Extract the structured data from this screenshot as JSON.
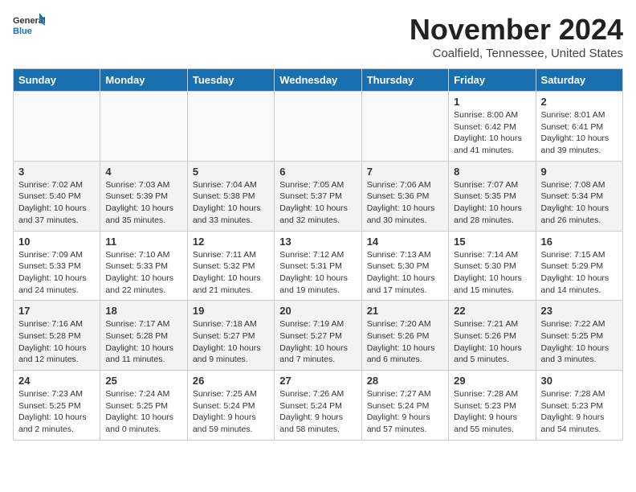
{
  "header": {
    "logo": {
      "general": "General",
      "blue": "Blue"
    },
    "month": "November 2024",
    "location": "Coalfield, Tennessee, United States"
  },
  "weekdays": [
    "Sunday",
    "Monday",
    "Tuesday",
    "Wednesday",
    "Thursday",
    "Friday",
    "Saturday"
  ],
  "weeks": [
    [
      {
        "day": "",
        "info": ""
      },
      {
        "day": "",
        "info": ""
      },
      {
        "day": "",
        "info": ""
      },
      {
        "day": "",
        "info": ""
      },
      {
        "day": "",
        "info": ""
      },
      {
        "day": "1",
        "info": "Sunrise: 8:00 AM\nSunset: 6:42 PM\nDaylight: 10 hours\nand 41 minutes."
      },
      {
        "day": "2",
        "info": "Sunrise: 8:01 AM\nSunset: 6:41 PM\nDaylight: 10 hours\nand 39 minutes."
      }
    ],
    [
      {
        "day": "3",
        "info": "Sunrise: 7:02 AM\nSunset: 5:40 PM\nDaylight: 10 hours\nand 37 minutes."
      },
      {
        "day": "4",
        "info": "Sunrise: 7:03 AM\nSunset: 5:39 PM\nDaylight: 10 hours\nand 35 minutes."
      },
      {
        "day": "5",
        "info": "Sunrise: 7:04 AM\nSunset: 5:38 PM\nDaylight: 10 hours\nand 33 minutes."
      },
      {
        "day": "6",
        "info": "Sunrise: 7:05 AM\nSunset: 5:37 PM\nDaylight: 10 hours\nand 32 minutes."
      },
      {
        "day": "7",
        "info": "Sunrise: 7:06 AM\nSunset: 5:36 PM\nDaylight: 10 hours\nand 30 minutes."
      },
      {
        "day": "8",
        "info": "Sunrise: 7:07 AM\nSunset: 5:35 PM\nDaylight: 10 hours\nand 28 minutes."
      },
      {
        "day": "9",
        "info": "Sunrise: 7:08 AM\nSunset: 5:34 PM\nDaylight: 10 hours\nand 26 minutes."
      }
    ],
    [
      {
        "day": "10",
        "info": "Sunrise: 7:09 AM\nSunset: 5:33 PM\nDaylight: 10 hours\nand 24 minutes."
      },
      {
        "day": "11",
        "info": "Sunrise: 7:10 AM\nSunset: 5:33 PM\nDaylight: 10 hours\nand 22 minutes."
      },
      {
        "day": "12",
        "info": "Sunrise: 7:11 AM\nSunset: 5:32 PM\nDaylight: 10 hours\nand 21 minutes."
      },
      {
        "day": "13",
        "info": "Sunrise: 7:12 AM\nSunset: 5:31 PM\nDaylight: 10 hours\nand 19 minutes."
      },
      {
        "day": "14",
        "info": "Sunrise: 7:13 AM\nSunset: 5:30 PM\nDaylight: 10 hours\nand 17 minutes."
      },
      {
        "day": "15",
        "info": "Sunrise: 7:14 AM\nSunset: 5:30 PM\nDaylight: 10 hours\nand 15 minutes."
      },
      {
        "day": "16",
        "info": "Sunrise: 7:15 AM\nSunset: 5:29 PM\nDaylight: 10 hours\nand 14 minutes."
      }
    ],
    [
      {
        "day": "17",
        "info": "Sunrise: 7:16 AM\nSunset: 5:28 PM\nDaylight: 10 hours\nand 12 minutes."
      },
      {
        "day": "18",
        "info": "Sunrise: 7:17 AM\nSunset: 5:28 PM\nDaylight: 10 hours\nand 11 minutes."
      },
      {
        "day": "19",
        "info": "Sunrise: 7:18 AM\nSunset: 5:27 PM\nDaylight: 10 hours\nand 9 minutes."
      },
      {
        "day": "20",
        "info": "Sunrise: 7:19 AM\nSunset: 5:27 PM\nDaylight: 10 hours\nand 7 minutes."
      },
      {
        "day": "21",
        "info": "Sunrise: 7:20 AM\nSunset: 5:26 PM\nDaylight: 10 hours\nand 6 minutes."
      },
      {
        "day": "22",
        "info": "Sunrise: 7:21 AM\nSunset: 5:26 PM\nDaylight: 10 hours\nand 5 minutes."
      },
      {
        "day": "23",
        "info": "Sunrise: 7:22 AM\nSunset: 5:25 PM\nDaylight: 10 hours\nand 3 minutes."
      }
    ],
    [
      {
        "day": "24",
        "info": "Sunrise: 7:23 AM\nSunset: 5:25 PM\nDaylight: 10 hours\nand 2 minutes."
      },
      {
        "day": "25",
        "info": "Sunrise: 7:24 AM\nSunset: 5:25 PM\nDaylight: 10 hours\nand 0 minutes."
      },
      {
        "day": "26",
        "info": "Sunrise: 7:25 AM\nSunset: 5:24 PM\nDaylight: 9 hours\nand 59 minutes."
      },
      {
        "day": "27",
        "info": "Sunrise: 7:26 AM\nSunset: 5:24 PM\nDaylight: 9 hours\nand 58 minutes."
      },
      {
        "day": "28",
        "info": "Sunrise: 7:27 AM\nSunset: 5:24 PM\nDaylight: 9 hours\nand 57 minutes."
      },
      {
        "day": "29",
        "info": "Sunrise: 7:28 AM\nSunset: 5:23 PM\nDaylight: 9 hours\nand 55 minutes."
      },
      {
        "day": "30",
        "info": "Sunrise: 7:28 AM\nSunset: 5:23 PM\nDaylight: 9 hours\nand 54 minutes."
      }
    ]
  ]
}
